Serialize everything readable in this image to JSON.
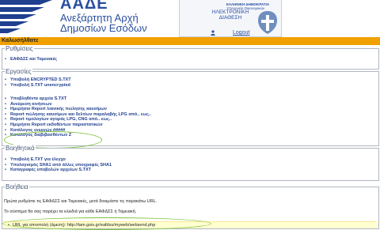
{
  "header": {
    "brand": "ΑΑΔΕ",
    "subtitle_line1": "Ανεξάρτητη Αρχή",
    "subtitle_line2": "Δημοσίων Εσόδων",
    "gov_line1": "ΕΛΛΗΝΙΚΗ ΔΗΜΟΚΡΑΤΙΑ",
    "gov_line2": "Υπουργείο Οικονομικών",
    "portal_line1": "ΗΛΕΚΤΡΟΝΙΚΗ",
    "portal_line2": "ΔΙΑΘΕΣΗ",
    "logout": "Logout"
  },
  "welcome": "Καλωσήλθατε",
  "sections": {
    "rythmiseis": {
      "title": "Ρυθμίσεις",
      "items": [
        "ΕΑΦΔΣΣ και Ταμειακές"
      ]
    },
    "ergasies": {
      "title": "Εργασίες",
      "group1": [
        "Υποβολή ENCRYPTED S.TXT",
        "Υποβολή S.TXT unencrypted"
      ],
      "group2": [
        "Υποβληθέντα αρχεία S.TXT",
        "Ανεύρεση κινήσεων",
        "Ημερήσιο Report λιανικής πώλησης καυσίμων",
        "Report πώλησης καυσίμων και δελτίων παραλαβής LPG από.. εως..",
        "Report τιμολογίων αγοράς LPG, CNG από.. εως..",
        "Ημερήσιο Report εκδοθέντων παραστατικών",
        "Κατάλογος ενεργών #####",
        "Κατάλογος διαβιβασθέντων Ζ"
      ]
    },
    "voithitika": {
      "title": "Βοηθητικά",
      "items": [
        "Υποβολή Ε.ΤΧΤ για έλεγχο",
        "Υπολογισμός SHA1 από άλλες υπογραφές SHA1",
        "Καταγραφές υποβολών αρχείων S.TXT"
      ]
    },
    "voitheia": {
      "title": "Βοήθεια",
      "text1": "Πρώτα ρυθμίστε τις ΕΑΦΔΣΣ και Ταμειακές, μετά δοκιμάστε τις παρακάτω URL.",
      "text2": "Το σύστημα θα σας παρέχει τα κλειδιά για κάθε ΕΑΦΔΣΣ ή Ταμειακή.",
      "url_item": "URL για αποστολή (άμεση): http://tam.gsis.gr/eafdss/myweb/websend.php"
    }
  },
  "colors": {
    "brand_blue": "#2a4ea0",
    "link_blue": "#1f3f8f",
    "welcome_bar": "#f0a000",
    "highlight_oval": "#7cc33a",
    "url_bar_bg": "#ffffd0"
  }
}
